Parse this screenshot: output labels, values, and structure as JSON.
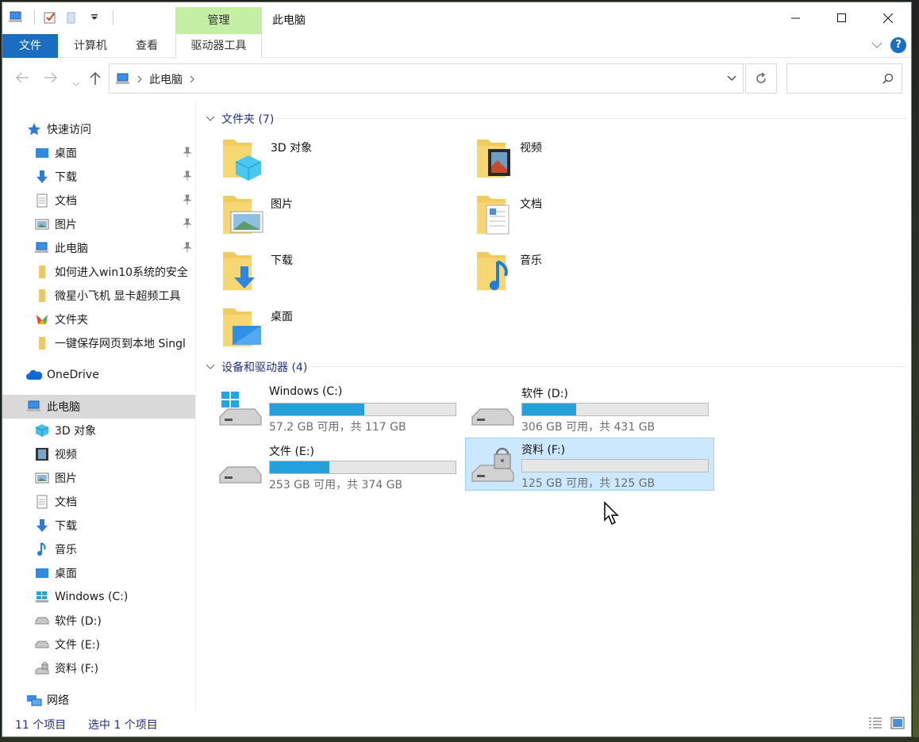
{
  "titlebar": {
    "manage_label": "管理",
    "title": "此电脑"
  },
  "ribbon": {
    "tabs": [
      "文件",
      "计算机",
      "查看",
      "驱动器工具"
    ],
    "help_label": "?"
  },
  "address": {
    "path": "此电脑"
  },
  "nav": {
    "quick_access": "快速访问",
    "quick_items": [
      "桌面",
      "下载",
      "文档",
      "图片",
      "此电脑",
      "如何进入win10系统的安全",
      "微星小飞机 显卡超频工具",
      "文件夹",
      "一键保存网页到本地 Singl"
    ],
    "onedrive": "OneDrive",
    "this_pc": "此电脑",
    "pc_items": [
      "3D 对象",
      "视频",
      "图片",
      "文档",
      "下载",
      "音乐",
      "桌面",
      "Windows (C:)",
      "软件 (D:)",
      "文件 (E:)",
      "资料 (F:)"
    ],
    "network": "网络"
  },
  "content": {
    "folders_header": "文件夹 (7)",
    "folders": [
      "3D 对象",
      "视频",
      "图片",
      "文档",
      "下载",
      "音乐",
      "桌面"
    ],
    "drives_header": "设备和驱动器 (4)",
    "drives": [
      {
        "name": "Windows (C:)",
        "info": "57.2 GB 可用，共 117 GB",
        "used": 0.51
      },
      {
        "name": "软件 (D:)",
        "info": "306 GB 可用，共 431 GB",
        "used": 0.29
      },
      {
        "name": "文件 (E:)",
        "info": "253 GB 可用，共 374 GB",
        "used": 0.32
      },
      {
        "name": "资料 (F:)",
        "info": "125 GB 可用，共 125 GB",
        "used": 0.0
      }
    ]
  },
  "status": {
    "count": "11 个项目",
    "selected": "选中 1 个项目"
  },
  "colors": {
    "accent": "#1a6dbf",
    "manage_tab": "#c6efa6",
    "bar_fill": "#26a0da",
    "selection": "#cce8ff"
  }
}
